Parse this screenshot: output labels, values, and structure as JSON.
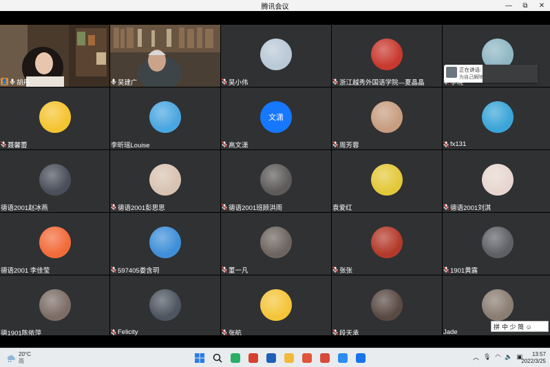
{
  "window": {
    "title": "腾讯会议",
    "minimize": "—",
    "maximize": "⧉",
    "close": "✕"
  },
  "participants": [
    {
      "name": "胡丹",
      "type": "video",
      "host": true,
      "mic": "on"
    },
    {
      "name": "吴建广",
      "type": "video",
      "mic": "on"
    },
    {
      "name": "吴小伟",
      "type": "avatar",
      "mic": "off",
      "color": "#b9c9d6"
    },
    {
      "name": "浙江越秀外国语学院—夏晶晶",
      "type": "avatar",
      "mic": "off",
      "color": "#c8392f"
    },
    {
      "name": "李晓",
      "type": "avatar",
      "mic": "off",
      "color": "#8fb7c4"
    },
    {
      "name": "聂馨蕾",
      "type": "avatar",
      "mic": "off",
      "color": "#f5c431"
    },
    {
      "name": "李昕瑶Louise",
      "type": "avatar",
      "mic": "none",
      "color": "#4aa6e0"
    },
    {
      "name": "高文潇",
      "type": "text-avatar",
      "mic": "off",
      "avatar_text": "文潇",
      "color": "#1677ff"
    },
    {
      "name": "周芳蓉",
      "type": "avatar",
      "mic": "off",
      "color": "#c79d80"
    },
    {
      "name": "fx131",
      "type": "avatar",
      "mic": "off",
      "color": "#3aa5d8"
    },
    {
      "name": "德语2001赵冰燕",
      "type": "avatar",
      "mic": "none",
      "color": "#4b4f5a"
    },
    {
      "name": "德语2001彭思思",
      "type": "avatar",
      "mic": "off",
      "color": "#d8c3b2"
    },
    {
      "name": "德语2001班顾洪雨",
      "type": "avatar",
      "mic": "off",
      "color": "#5e5b5a"
    },
    {
      "name": "袁爱红",
      "type": "avatar",
      "mic": "none",
      "color": "#e3c83a"
    },
    {
      "name": "德语2001刘淇",
      "type": "avatar",
      "mic": "off",
      "color": "#e7d6cf"
    },
    {
      "name": "德语2001 李佳莹",
      "type": "avatar",
      "mic": "none",
      "color": "#f26b3a"
    },
    {
      "name": "597405娄含玥",
      "type": "avatar",
      "mic": "off",
      "color": "#3f8fd8"
    },
    {
      "name": "董一凡",
      "type": "avatar",
      "mic": "off",
      "color": "#6d655f"
    },
    {
      "name": "张张",
      "type": "avatar",
      "mic": "off",
      "color": "#b33a2a"
    },
    {
      "name": "1901黄露",
      "type": "avatar",
      "mic": "off",
      "color": "#5f6066"
    },
    {
      "name": "德1901陈依萍",
      "type": "avatar",
      "mic": "none",
      "color": "#7c6d66"
    },
    {
      "name": "Felicity",
      "type": "avatar",
      "mic": "off",
      "color": "#4d5560"
    },
    {
      "name": "张航",
      "type": "avatar",
      "mic": "off",
      "color": "#f4c53a"
    },
    {
      "name": "段天承",
      "type": "avatar",
      "mic": "off",
      "color": "#5a4a44"
    },
    {
      "name": "Jade",
      "type": "avatar",
      "mic": "none",
      "color": "#8a7d72"
    }
  ],
  "speaking_popup": {
    "line1": "正在讲话:",
    "line2": "为自己解除静音"
  },
  "ime": {
    "label": "中 少 简 ☺",
    "mode": "拼"
  },
  "taskbar": {
    "weather_temp": "20°C",
    "weather_desc": "雨",
    "time": "13:57",
    "date": "2022/3/25",
    "apps": [
      "windows-start",
      "search",
      "wechat",
      "app-red",
      "app-grid",
      "file-explorer",
      "office",
      "chrome",
      "app-bird",
      "tencent-meeting"
    ]
  }
}
